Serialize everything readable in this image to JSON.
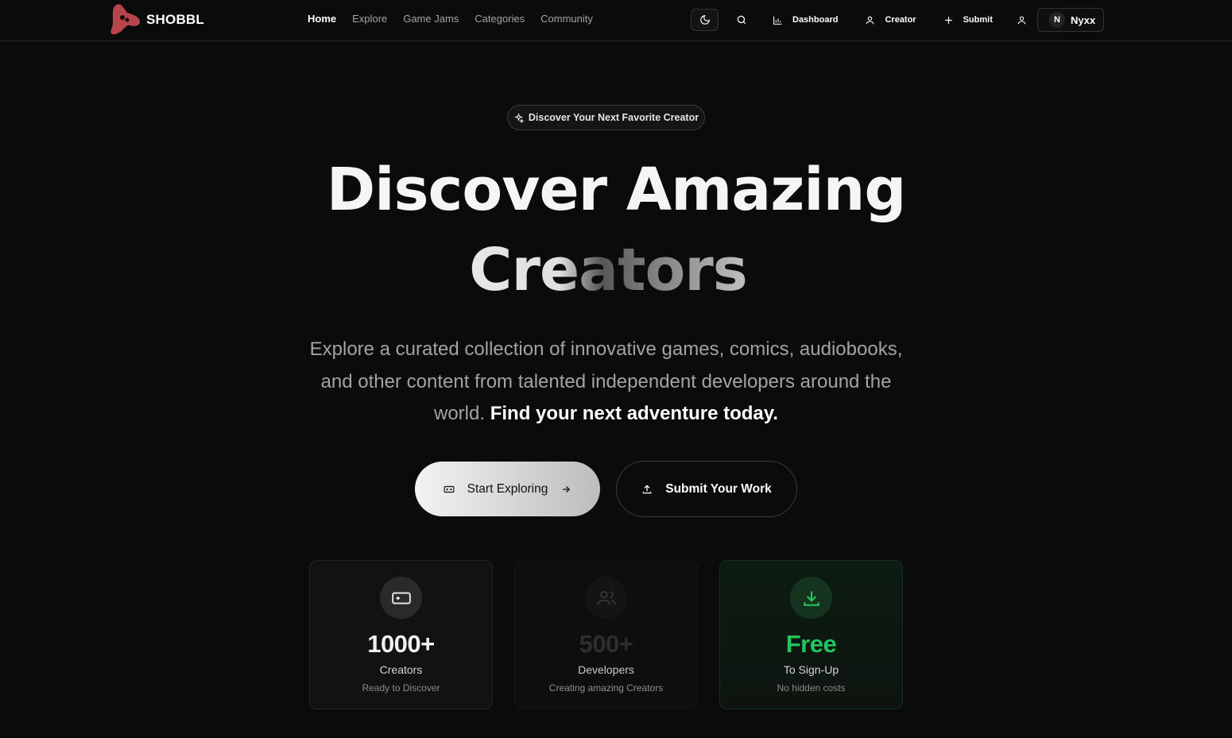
{
  "brand": {
    "name": "SHOBBL",
    "logo_color": "#b8454d"
  },
  "nav": {
    "links": [
      "Home",
      "Explore",
      "Game Jams",
      "Categories",
      "Community"
    ],
    "active": "Home",
    "dashboard_label": "Dashboard",
    "creator_label": "Creator",
    "submit_label": "Submit",
    "user": {
      "initial": "N",
      "name": "Nyxx"
    }
  },
  "hero": {
    "badge": "Discover Your Next Favorite Creator",
    "title_line1": "Discover Amazing",
    "title_line2": "Creators",
    "subtitle": "Explore a curated collection of innovative games, comics, audiobooks, and other content from talented independent developers around the world.",
    "subtitle_bold": "Find your next adventure today.",
    "primary_button": "Start Exploring",
    "secondary_button": "Submit Your Work"
  },
  "stats": [
    {
      "value": "1000+",
      "label": "Creators",
      "note": "Ready to Discover",
      "icon": "gamepad-icon"
    },
    {
      "value": "500+",
      "label": "Developers",
      "note": "Creating amazing Creators",
      "icon": "users-icon"
    },
    {
      "value": "Free",
      "label": "To Sign-Up",
      "note": "No hidden costs",
      "icon": "download-icon",
      "accent": "#22c55e"
    }
  ]
}
